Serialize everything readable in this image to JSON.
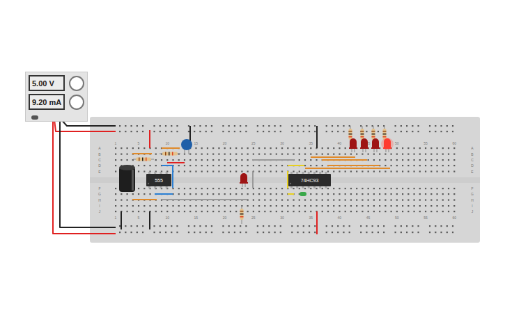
{
  "power_supply": {
    "voltage": "5.00 V",
    "current": "9.20 mA"
  },
  "chips": [
    {
      "label": "555"
    },
    {
      "label": "74HC93"
    }
  ],
  "column_numbers": [
    "1",
    "5",
    "10",
    "15",
    "20",
    "25",
    "30",
    "35",
    "40",
    "45",
    "50",
    "55",
    "60"
  ],
  "row_letters_top": [
    "A",
    "B",
    "C",
    "D",
    "E"
  ],
  "row_letters_bottom": [
    "F",
    "G",
    "H",
    "I",
    "J"
  ],
  "leds": [
    {
      "lit": false
    },
    {
      "lit": false
    },
    {
      "lit": false
    },
    {
      "lit": true
    },
    {
      "lit": false
    }
  ]
}
